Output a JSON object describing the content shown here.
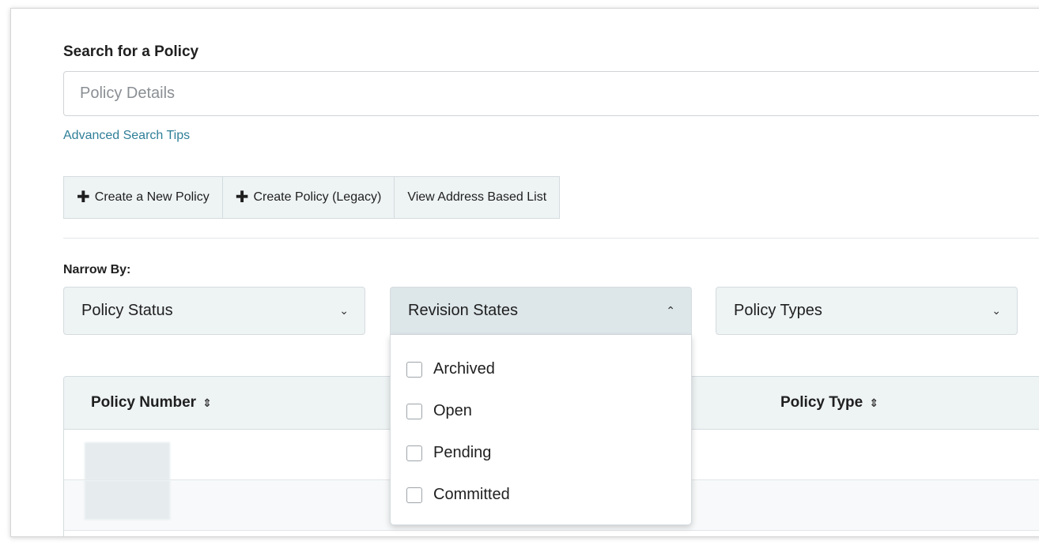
{
  "search": {
    "label": "Search for a Policy",
    "placeholder": "Policy Details",
    "value": "",
    "tips_link": "Advanced Search Tips"
  },
  "actions": [
    {
      "label": "Create a New Policy",
      "icon": "plus-icon"
    },
    {
      "label": "Create Policy (Legacy)",
      "icon": "plus-icon"
    },
    {
      "label": "View Address Based List"
    }
  ],
  "filters": {
    "label": "Narrow By:",
    "dropdowns": [
      {
        "label": "Policy Status",
        "state": "collapsed",
        "icon": "chevron-down-icon"
      },
      {
        "label": "Revision States",
        "state": "expanded",
        "icon": "chevron-up-icon"
      },
      {
        "label": "Policy Types",
        "state": "collapsed",
        "icon": "chevron-down-icon"
      }
    ],
    "revision_options": [
      {
        "label": "Archived",
        "checked": false
      },
      {
        "label": "Open",
        "checked": false
      },
      {
        "label": "Pending",
        "checked": false
      },
      {
        "label": "Committed",
        "checked": false
      }
    ]
  },
  "table": {
    "columns": [
      {
        "label": "Policy Number",
        "sortable": true,
        "icon": "sort-icon"
      },
      {
        "label": "Policy Type",
        "sortable": true,
        "icon": "sort-icon"
      }
    ],
    "rows": [
      {
        "policy_number": "",
        "policy_type": "",
        "redacted": true
      },
      {
        "policy_number": "",
        "policy_type": "",
        "redacted": true
      }
    ]
  },
  "colors": {
    "link": "#2f7f98",
    "panel_bg": "#eef3f4",
    "border": "#d5dcdf"
  }
}
